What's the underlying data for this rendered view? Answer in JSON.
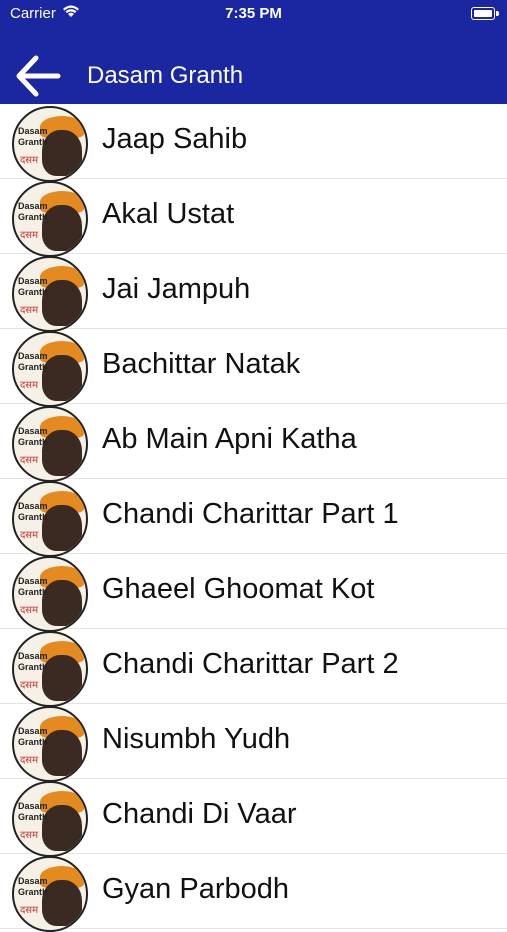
{
  "status": {
    "carrier": "Carrier",
    "time": "7:35 PM"
  },
  "header": {
    "title": "Dasam Granth"
  },
  "avatar": {
    "line1": "Dasam",
    "line2": "Granth",
    "line3": "दसम"
  },
  "items": [
    {
      "label": "Jaap Sahib"
    },
    {
      "label": "Akal Ustat"
    },
    {
      "label": "Jai Jampuh"
    },
    {
      "label": "Bachittar Natak"
    },
    {
      "label": "Ab Main Apni Katha"
    },
    {
      "label": "Chandi Charittar Part 1"
    },
    {
      "label": "Ghaeel Ghoomat Kot"
    },
    {
      "label": "Chandi Charittar Part 2"
    },
    {
      "label": "Nisumbh Yudh"
    },
    {
      "label": "Chandi Di Vaar"
    },
    {
      "label": "Gyan Parbodh"
    }
  ]
}
